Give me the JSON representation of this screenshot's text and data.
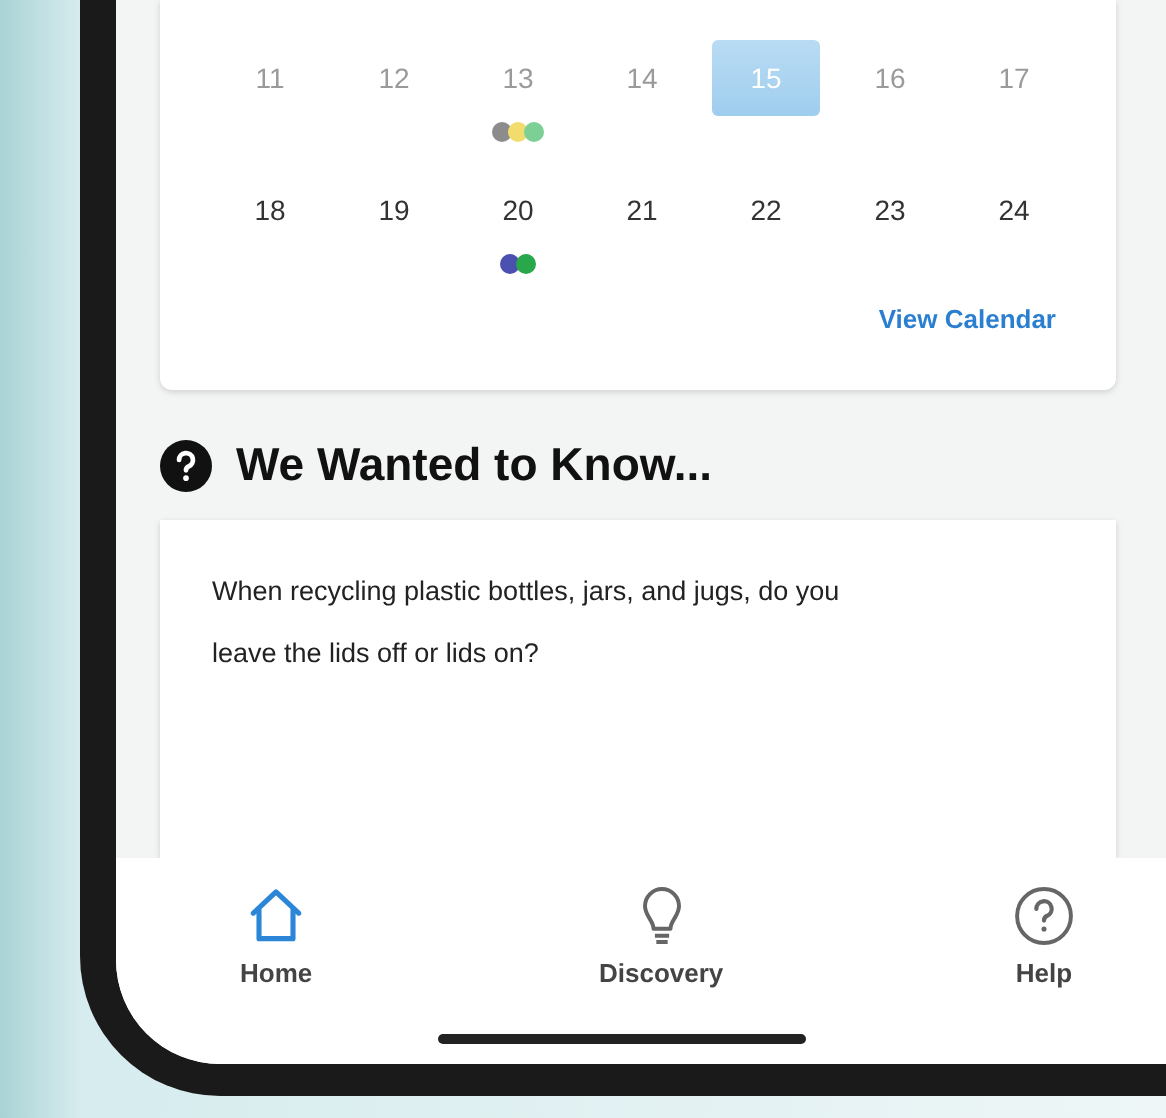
{
  "calendar": {
    "weeks": [
      {
        "days": [
          {
            "label": "11",
            "past": true,
            "selected": false
          },
          {
            "label": "12",
            "past": true,
            "selected": false
          },
          {
            "label": "13",
            "past": true,
            "selected": false,
            "dots": [
              {
                "color": "#8c8c8c"
              },
              {
                "color": "#f3dc6e"
              },
              {
                "color": "#7ccf95"
              }
            ]
          },
          {
            "label": "14",
            "past": true,
            "selected": false
          },
          {
            "label": "15",
            "past": false,
            "selected": true
          },
          {
            "label": "16",
            "past": true,
            "selected": false
          },
          {
            "label": "17",
            "past": true,
            "selected": false
          }
        ]
      },
      {
        "days": [
          {
            "label": "18",
            "past": false,
            "selected": false
          },
          {
            "label": "19",
            "past": false,
            "selected": false
          },
          {
            "label": "20",
            "past": false,
            "selected": false,
            "dots": [
              {
                "color": "#4a4fb0"
              },
              {
                "color": "#28a84a"
              }
            ]
          },
          {
            "label": "21",
            "past": false,
            "selected": false
          },
          {
            "label": "22",
            "past": false,
            "selected": false
          },
          {
            "label": "23",
            "past": false,
            "selected": false
          },
          {
            "label": "24",
            "past": false,
            "selected": false
          }
        ]
      }
    ],
    "link": "View Calendar"
  },
  "section": {
    "title": "We Wanted to Know...",
    "question": "When recycling plastic bottles, jars, and jugs, do you leave the lids off or lids on?"
  },
  "nav": [
    {
      "label": "Home",
      "selected": true
    },
    {
      "label": "Discovery",
      "selected": false
    },
    {
      "label": "Help",
      "selected": false
    }
  ]
}
